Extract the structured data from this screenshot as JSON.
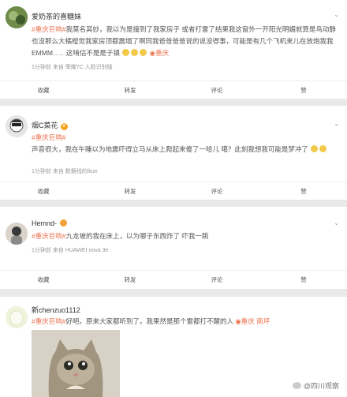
{
  "colors": {
    "accent": "#eb7350",
    "background": "#e9e9e9"
  },
  "posts": [
    {
      "user": "爱奶茶的喜糖妹",
      "tag": "#重庆巨响#",
      "text": "我莫名其妙，我以为是撞到了我家房子 或者打雷了结果我这窗外一开阳光明媚就算是鸟动静也没那么大橘橙觉我家房顶都震塌了啊同我爸爸爸爸说的说没得事，可能是有几个飞机来儿在放炮我我EMMM……这啃估不是是子镇",
      "location": "重庆",
      "meta": "1分钟前 来自 荣耀7C 人脸识别版",
      "actions": [
        "收藏",
        "转发",
        "评论",
        "赞"
      ]
    },
    {
      "user": "烟C菜花",
      "tag": "#重庆巨响#",
      "text": "声音很大，我在午睡以为地震吓得立马从床上爬起来傻了一哈儿 噶？此刻我想我可能是梦冲了",
      "meta": "1分钟前 来自 数据线的ikun",
      "actions": [
        "收藏",
        "转发",
        "评论",
        "赞"
      ]
    },
    {
      "user": "Hemnd-",
      "tag": "#重庆巨响#",
      "text": "九龙坡的我在床上，以为哪子东西炸了 吓我一跳",
      "meta": "1分钟前 来自 HUAWEI nova 3e",
      "actions": [
        "收藏",
        "转发",
        "评论",
        "赞"
      ]
    },
    {
      "user": "新chenzuo1112",
      "tag": "#重庆巨响#",
      "text": "好吧。原来大家都听到了。我果然是那个雷都打不醒的人",
      "location": "重庆 南坪"
    }
  ],
  "watermark": "@四川观察"
}
